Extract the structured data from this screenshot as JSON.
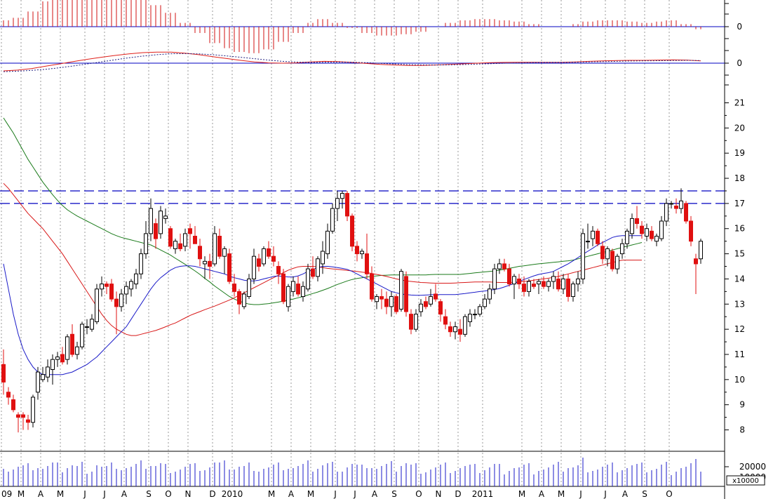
{
  "chart_data": {
    "type": "candlestick",
    "panels": [
      {
        "name": "macd_histogram",
        "zero_label": "0"
      },
      {
        "name": "macd_lines",
        "zero_label": "0",
        "series": [
          {
            "color": "#e0201a",
            "values": [
              -0.5,
              -0.45,
              -0.35,
              -0.2,
              -0.05,
              0.1,
              0.25,
              0.38,
              0.5,
              0.6,
              0.68,
              0.72,
              0.72,
              0.65,
              0.55,
              0.42,
              0.3,
              0.18,
              0.08,
              0.02,
              0,
              0.02,
              0.08,
              0.12,
              0.1,
              0.05,
              -0.02,
              -0.08,
              -0.12,
              -0.15,
              -0.15,
              -0.12,
              -0.08,
              -0.04,
              0,
              0.03,
              0.05,
              0.06,
              0.06,
              0.05,
              0.05,
              0.08,
              0.12,
              0.15,
              0.17,
              0.18,
              0.18,
              0.2,
              0.22,
              0.2,
              0.15
            ]
          },
          {
            "color": "#202080",
            "dashed": true,
            "values": [
              -0.55,
              -0.52,
              -0.47,
              -0.4,
              -0.3,
              -0.18,
              -0.05,
              0.08,
              0.22,
              0.35,
              0.46,
              0.55,
              0.61,
              0.62,
              0.6,
              0.55,
              0.47,
              0.38,
              0.29,
              0.2,
              0.12,
              0.07,
              0.05,
              0.06,
              0.07,
              0.06,
              0.03,
              -0.01,
              -0.05,
              -0.09,
              -0.11,
              -0.12,
              -0.11,
              -0.09,
              -0.06,
              -0.03,
              0,
              0.02,
              0.04,
              0.05,
              0.05,
              0.06,
              0.08,
              0.1,
              0.12,
              0.14,
              0.15,
              0.16,
              0.17,
              0.18,
              0.17
            ]
          }
        ]
      }
    ],
    "y_ticks": [
      8,
      9,
      10,
      11,
      12,
      13,
      14,
      15,
      16,
      17,
      18,
      19,
      20,
      21
    ],
    "ylim": [
      7.15,
      21.6
    ],
    "resistance_levels": [
      17.0,
      17.5
    ],
    "months": [
      {
        "label": "09",
        "i": 0
      },
      {
        "label": "M",
        "i": 4
      },
      {
        "label": "A",
        "i": 8
      },
      {
        "label": "M",
        "i": 12
      },
      {
        "label": "J",
        "i": 17
      },
      {
        "label": "J",
        "i": 21
      },
      {
        "label": "A",
        "i": 25
      },
      {
        "label": "S",
        "i": 30
      },
      {
        "label": "O",
        "i": 34
      },
      {
        "label": "N",
        "i": 38
      },
      {
        "label": "D",
        "i": 43
      },
      {
        "label": "2010",
        "i": 47
      },
      {
        "label": "M",
        "i": 55
      },
      {
        "label": "A",
        "i": 59
      },
      {
        "label": "M",
        "i": 63
      },
      {
        "label": "J",
        "i": 68
      },
      {
        "label": "J",
        "i": 72
      },
      {
        "label": "A",
        "i": 76
      },
      {
        "label": "S",
        "i": 80
      },
      {
        "label": "O",
        "i": 85
      },
      {
        "label": "N",
        "i": 89
      },
      {
        "label": "D",
        "i": 93
      },
      {
        "label": "2011",
        "i": 98
      },
      {
        "label": "M",
        "i": 106
      },
      {
        "label": "A",
        "i": 110
      },
      {
        "label": "M",
        "i": 114
      },
      {
        "label": "J",
        "i": 118
      },
      {
        "label": "J",
        "i": 123
      },
      {
        "label": "A",
        "i": 127
      },
      {
        "label": "S",
        "i": 131
      },
      {
        "label": "O",
        "i": 136
      }
    ],
    "volume_ticks": [
      "20000",
      "10000"
    ],
    "volume_unit": "x10000",
    "candles": [
      [
        10.6,
        11.2,
        9.4,
        9.9
      ],
      [
        9.5,
        9.7,
        9.0,
        9.3
      ],
      [
        9.2,
        9.4,
        8.7,
        8.8
      ],
      [
        8.6,
        8.7,
        7.9,
        8.5
      ],
      [
        8.6,
        8.7,
        8.0,
        8.5
      ],
      [
        8.4,
        8.6,
        8.0,
        8.3
      ],
      [
        8.3,
        9.4,
        8.1,
        9.3
      ],
      [
        9.5,
        10.5,
        9.2,
        10.3
      ],
      [
        10.0,
        10.5,
        9.9,
        10.2
      ],
      [
        10.1,
        10.8,
        9.9,
        10.5
      ],
      [
        10.4,
        11.0,
        9.8,
        10.8
      ],
      [
        10.8,
        11.1,
        10.5,
        10.9
      ],
      [
        11.0,
        11.3,
        10.6,
        10.7
      ],
      [
        10.8,
        11.8,
        10.6,
        11.7
      ],
      [
        11.8,
        12.2,
        10.9,
        11.0
      ],
      [
        11.0,
        11.5,
        10.8,
        11.3
      ],
      [
        11.3,
        12.3,
        11.2,
        12.2
      ],
      [
        12.1,
        12.4,
        11.8,
        12.1
      ],
      [
        12.0,
        12.6,
        11.9,
        12.4
      ],
      [
        12.3,
        13.8,
        12.2,
        13.6
      ],
      [
        13.6,
        14.1,
        13.3,
        13.8
      ],
      [
        13.8,
        13.9,
        13.4,
        13.7
      ],
      [
        13.8,
        14.0,
        13.1,
        13.2
      ],
      [
        13.2,
        13.5,
        11.8,
        12.9
      ],
      [
        12.9,
        13.6,
        12.7,
        13.4
      ],
      [
        13.4,
        13.9,
        13.0,
        13.7
      ],
      [
        13.6,
        14.0,
        13.3,
        13.9
      ],
      [
        13.8,
        14.4,
        13.6,
        14.2
      ],
      [
        14.2,
        15.2,
        14.0,
        15.0
      ],
      [
        15.0,
        16.3,
        14.8,
        15.8
      ],
      [
        15.8,
        17.2,
        15.5,
        16.8
      ],
      [
        16.2,
        16.4,
        15.2,
        15.6
      ],
      [
        15.8,
        16.9,
        15.6,
        16.7
      ],
      [
        16.4,
        16.8,
        16.2,
        16.5
      ],
      [
        16.0,
        16.1,
        15.2,
        15.3
      ],
      [
        15.2,
        15.6,
        15.0,
        15.5
      ],
      [
        15.4,
        15.8,
        15.1,
        15.2
      ],
      [
        15.3,
        16.0,
        15.1,
        15.8
      ],
      [
        16.0,
        16.2,
        15.2,
        15.8
      ],
      [
        15.7,
        16.1,
        15.5,
        15.4
      ],
      [
        15.3,
        15.6,
        14.5,
        14.8
      ],
      [
        14.6,
        14.9,
        14.0,
        14.7
      ],
      [
        14.7,
        15.0,
        14.0,
        14.5
      ],
      [
        14.6,
        16.1,
        14.5,
        15.8
      ],
      [
        15.7,
        16.0,
        14.8,
        14.9
      ],
      [
        14.9,
        15.3,
        14.2,
        15.2
      ],
      [
        15.0,
        15.2,
        13.8,
        13.9
      ],
      [
        13.8,
        14.2,
        13.3,
        13.5
      ],
      [
        13.5,
        13.6,
        12.6,
        13.0
      ],
      [
        12.9,
        13.5,
        12.8,
        13.4
      ],
      [
        13.3,
        14.2,
        13.2,
        14.0
      ],
      [
        14.0,
        15.2,
        13.8,
        14.9
      ],
      [
        14.8,
        15.0,
        14.3,
        14.5
      ],
      [
        14.6,
        15.3,
        14.5,
        15.2
      ],
      [
        15.2,
        15.5,
        14.8,
        14.9
      ],
      [
        14.9,
        15.3,
        14.5,
        14.7
      ],
      [
        14.5,
        14.7,
        13.8,
        14.2
      ],
      [
        14.2,
        14.4,
        13.0,
        13.1
      ],
      [
        12.9,
        13.8,
        12.7,
        13.7
      ],
      [
        13.5,
        14.1,
        13.3,
        13.9
      ],
      [
        13.8,
        14.1,
        13.3,
        13.4
      ],
      [
        13.3,
        13.9,
        13.1,
        13.7
      ],
      [
        13.6,
        14.6,
        13.5,
        14.4
      ],
      [
        14.4,
        14.9,
        14.0,
        14.1
      ],
      [
        14.1,
        14.9,
        13.9,
        14.8
      ],
      [
        14.6,
        15.5,
        14.2,
        15.1
      ],
      [
        15.0,
        16.2,
        14.8,
        15.9
      ],
      [
        15.9,
        17.0,
        15.8,
        16.8
      ],
      [
        16.8,
        17.5,
        16.3,
        17.2
      ],
      [
        17.2,
        17.5,
        16.8,
        17.4
      ],
      [
        17.4,
        17.5,
        16.3,
        16.5
      ],
      [
        16.5,
        16.6,
        15.1,
        15.3
      ],
      [
        15.3,
        15.5,
        14.7,
        15.0
      ],
      [
        15.0,
        15.2,
        14.8,
        15.1
      ],
      [
        15.0,
        15.8,
        14.0,
        14.2
      ],
      [
        14.2,
        14.5,
        13.1,
        13.2
      ],
      [
        13.1,
        13.4,
        12.8,
        13.3
      ],
      [
        13.3,
        13.6,
        12.8,
        13.2
      ],
      [
        13.2,
        13.5,
        12.6,
        12.9
      ],
      [
        12.9,
        13.5,
        12.5,
        13.3
      ],
      [
        13.3,
        13.4,
        12.6,
        12.7
      ],
      [
        12.8,
        14.4,
        12.7,
        14.3
      ],
      [
        14.1,
        14.3,
        12.5,
        12.7
      ],
      [
        12.6,
        12.8,
        11.8,
        12.0
      ],
      [
        12.0,
        12.8,
        11.9,
        12.6
      ],
      [
        12.7,
        13.2,
        12.5,
        13.0
      ],
      [
        13.1,
        13.3,
        12.8,
        12.9
      ],
      [
        13.0,
        13.6,
        12.9,
        13.3
      ],
      [
        13.4,
        13.8,
        13.1,
        13.2
      ],
      [
        13.1,
        13.2,
        12.3,
        12.6
      ],
      [
        12.5,
        12.8,
        12.0,
        12.2
      ],
      [
        12.1,
        12.3,
        11.7,
        11.9
      ],
      [
        11.9,
        12.3,
        11.6,
        12.1
      ],
      [
        12.0,
        12.4,
        11.5,
        11.8
      ],
      [
        11.8,
        12.6,
        11.7,
        12.5
      ],
      [
        12.3,
        12.8,
        12.1,
        12.6
      ],
      [
        12.6,
        12.8,
        12.4,
        12.6
      ],
      [
        12.6,
        13.0,
        12.5,
        12.9
      ],
      [
        12.9,
        13.4,
        12.8,
        13.2
      ],
      [
        13.2,
        13.8,
        13.0,
        13.6
      ],
      [
        13.6,
        14.6,
        13.4,
        14.4
      ],
      [
        14.4,
        14.8,
        14.2,
        14.6
      ],
      [
        14.6,
        14.8,
        14.3,
        14.4
      ],
      [
        14.4,
        14.6,
        13.7,
        13.8
      ],
      [
        13.8,
        14.2,
        13.2,
        14.1
      ],
      [
        14.0,
        14.2,
        13.6,
        13.8
      ],
      [
        13.8,
        14.1,
        13.3,
        13.5
      ],
      [
        13.5,
        14.0,
        13.3,
        13.9
      ],
      [
        13.8,
        14.0,
        13.6,
        13.7
      ],
      [
        13.8,
        14.0,
        13.4,
        13.9
      ],
      [
        13.9,
        14.1,
        13.6,
        13.7
      ],
      [
        13.7,
        14.0,
        13.5,
        13.9
      ],
      [
        13.9,
        14.3,
        13.6,
        14.1
      ],
      [
        14.0,
        14.3,
        13.5,
        13.6
      ],
      [
        13.6,
        14.2,
        13.4,
        14.0
      ],
      [
        14.0,
        14.2,
        13.1,
        13.3
      ],
      [
        13.3,
        13.9,
        13.1,
        13.8
      ],
      [
        13.8,
        14.3,
        13.5,
        14.0
      ],
      [
        14.0,
        16.0,
        13.8,
        15.8
      ],
      [
        15.5,
        16.2,
        15.2,
        15.5
      ],
      [
        15.6,
        16.1,
        15.3,
        15.9
      ],
      [
        15.9,
        16.0,
        15.3,
        15.4
      ],
      [
        15.3,
        15.5,
        14.6,
        14.8
      ],
      [
        14.8,
        15.3,
        14.5,
        15.2
      ],
      [
        15.1,
        15.2,
        14.3,
        14.4
      ],
      [
        14.4,
        15.0,
        14.2,
        14.9
      ],
      [
        15.0,
        15.6,
        14.8,
        15.4
      ],
      [
        15.4,
        16.0,
        15.2,
        15.9
      ],
      [
        15.8,
        16.6,
        15.6,
        16.4
      ],
      [
        16.4,
        16.9,
        16.0,
        16.2
      ],
      [
        16.1,
        16.3,
        15.6,
        15.8
      ],
      [
        15.7,
        16.2,
        15.5,
        16.0
      ],
      [
        15.9,
        16.1,
        15.5,
        15.6
      ],
      [
        15.5,
        15.8,
        15.3,
        15.7
      ],
      [
        15.6,
        16.5,
        15.5,
        16.3
      ],
      [
        16.3,
        17.2,
        16.1,
        17.0
      ],
      [
        17.0,
        17.1,
        16.8,
        17.0
      ],
      [
        16.9,
        17.2,
        16.6,
        16.8
      ],
      [
        16.8,
        17.6,
        16.6,
        17.1
      ],
      [
        17.0,
        17.1,
        16.2,
        16.3
      ],
      [
        16.3,
        16.5,
        15.3,
        15.5
      ],
      [
        14.8,
        15.0,
        13.4,
        14.6
      ],
      [
        14.8,
        15.6,
        14.6,
        15.5
      ]
    ],
    "ma_blue": [
      14.6,
      13.6,
      12.6,
      11.8,
      11.2,
      10.8,
      10.5,
      10.3,
      10.2,
      10.2,
      10.2,
      10.2,
      10.2,
      10.25,
      10.3,
      10.4,
      10.5,
      10.6,
      10.75,
      10.9,
      11.1,
      11.3,
      11.5,
      11.7,
      11.9,
      12.1,
      12.4,
      12.7,
      13.0,
      13.3,
      13.6,
      13.85,
      14.05,
      14.2,
      14.35,
      14.45,
      14.5,
      14.52,
      14.52,
      14.5,
      14.45,
      14.4,
      14.35,
      14.3,
      14.25,
      14.2,
      14.12,
      14.05,
      14.0,
      13.95,
      13.92,
      13.92,
      13.95,
      14.0,
      14.05,
      14.1,
      14.12,
      14.1,
      14.08,
      14.08,
      14.12,
      14.2,
      14.3,
      14.38,
      14.45,
      14.5,
      14.5,
      14.48,
      14.45,
      14.42,
      14.38,
      14.3,
      14.2,
      14.1,
      14.0,
      13.9,
      13.8,
      13.7,
      13.6,
      13.5,
      13.45,
      13.4,
      13.38,
      13.36,
      13.35,
      13.35,
      13.36,
      13.37,
      13.38,
      13.38,
      13.38,
      13.38,
      13.38,
      13.4,
      13.42,
      13.45,
      13.47,
      13.5,
      13.52,
      13.55,
      13.58,
      13.62,
      13.68,
      13.75,
      13.82,
      13.9,
      13.98,
      14.05,
      14.12,
      14.18,
      14.22,
      14.25,
      14.3,
      14.4,
      14.5,
      14.6,
      14.72,
      14.85,
      14.98,
      15.1,
      15.22,
      15.35,
      15.45,
      15.55,
      15.65,
      15.7,
      15.72,
      15.72,
      15.72,
      15.72,
      15.72
    ],
    "ma_red": [
      17.8,
      17.6,
      17.35,
      17.1,
      16.85,
      16.6,
      16.4,
      16.2,
      16.0,
      15.75,
      15.5,
      15.25,
      15.0,
      14.7,
      14.4,
      14.1,
      13.8,
      13.5,
      13.2,
      12.9,
      12.6,
      12.35,
      12.15,
      12.0,
      11.9,
      11.8,
      11.75,
      11.75,
      11.8,
      11.85,
      11.9,
      11.95,
      12.02,
      12.1,
      12.18,
      12.25,
      12.35,
      12.45,
      12.55,
      12.63,
      12.7,
      12.78,
      12.85,
      12.92,
      13.0,
      13.08,
      13.16,
      13.25,
      13.35,
      13.45,
      13.55,
      13.65,
      13.75,
      13.85,
      13.95,
      14.05,
      14.15,
      14.25,
      14.35,
      14.42,
      14.48,
      14.5,
      14.5,
      14.5,
      14.48,
      14.45,
      14.42,
      14.4,
      14.38,
      14.36,
      14.34,
      14.32,
      14.3,
      14.27,
      14.25,
      14.22,
      14.18,
      14.14,
      14.1,
      14.05,
      14.0,
      13.96,
      13.92,
      13.9,
      13.88,
      13.86,
      13.85,
      13.84,
      13.83,
      13.83,
      13.83,
      13.83,
      13.84,
      13.85,
      13.86,
      13.87,
      13.88,
      13.88,
      13.88,
      13.88,
      13.87,
      13.86,
      13.86,
      13.86,
      13.87,
      13.88,
      13.9,
      13.92,
      13.95,
      13.98,
      14.0,
      14.03,
      14.06,
      14.1,
      14.15,
      14.2,
      14.25,
      14.3,
      14.35,
      14.4,
      14.45,
      14.5,
      14.55,
      14.6,
      14.65,
      14.7,
      14.75,
      14.75,
      14.75,
      14.75,
      14.75
    ],
    "ma_green": [
      20.4,
      20.1,
      19.8,
      19.45,
      19.1,
      18.75,
      18.45,
      18.15,
      17.85,
      17.6,
      17.35,
      17.12,
      16.92,
      16.75,
      16.62,
      16.5,
      16.4,
      16.3,
      16.2,
      16.1,
      16.0,
      15.9,
      15.8,
      15.72,
      15.65,
      15.6,
      15.55,
      15.5,
      15.45,
      15.4,
      15.35,
      15.25,
      15.15,
      15.05,
      14.95,
      14.82,
      14.7,
      14.58,
      14.45,
      14.32,
      14.18,
      14.02,
      13.88,
      13.72,
      13.58,
      13.44,
      13.3,
      13.2,
      13.12,
      13.05,
      13.0,
      12.98,
      12.98,
      13.0,
      13.02,
      13.05,
      13.08,
      13.12,
      13.16,
      13.2,
      13.25,
      13.3,
      13.36,
      13.42,
      13.48,
      13.55,
      13.62,
      13.7,
      13.78,
      13.85,
      13.92,
      13.98,
      14.02,
      14.05,
      14.08,
      14.1,
      14.12,
      14.14,
      14.15,
      14.16,
      14.16,
      14.16,
      14.16,
      14.16,
      14.16,
      14.16,
      14.16,
      14.17,
      14.18,
      14.18,
      14.18,
      14.18,
      14.18,
      14.18,
      14.2,
      14.22,
      14.24,
      14.26,
      14.28,
      14.3,
      14.32,
      14.35,
      14.38,
      14.42,
      14.46,
      14.5,
      14.52,
      14.55,
      14.58,
      14.6,
      14.62,
      14.64,
      14.66,
      14.68,
      14.7,
      14.72,
      14.75,
      14.8,
      14.85,
      14.9,
      14.95,
      15.0,
      15.05,
      15.1,
      15.15,
      15.2,
      15.25,
      15.3,
      15.35,
      15.4,
      15.45
    ]
  }
}
